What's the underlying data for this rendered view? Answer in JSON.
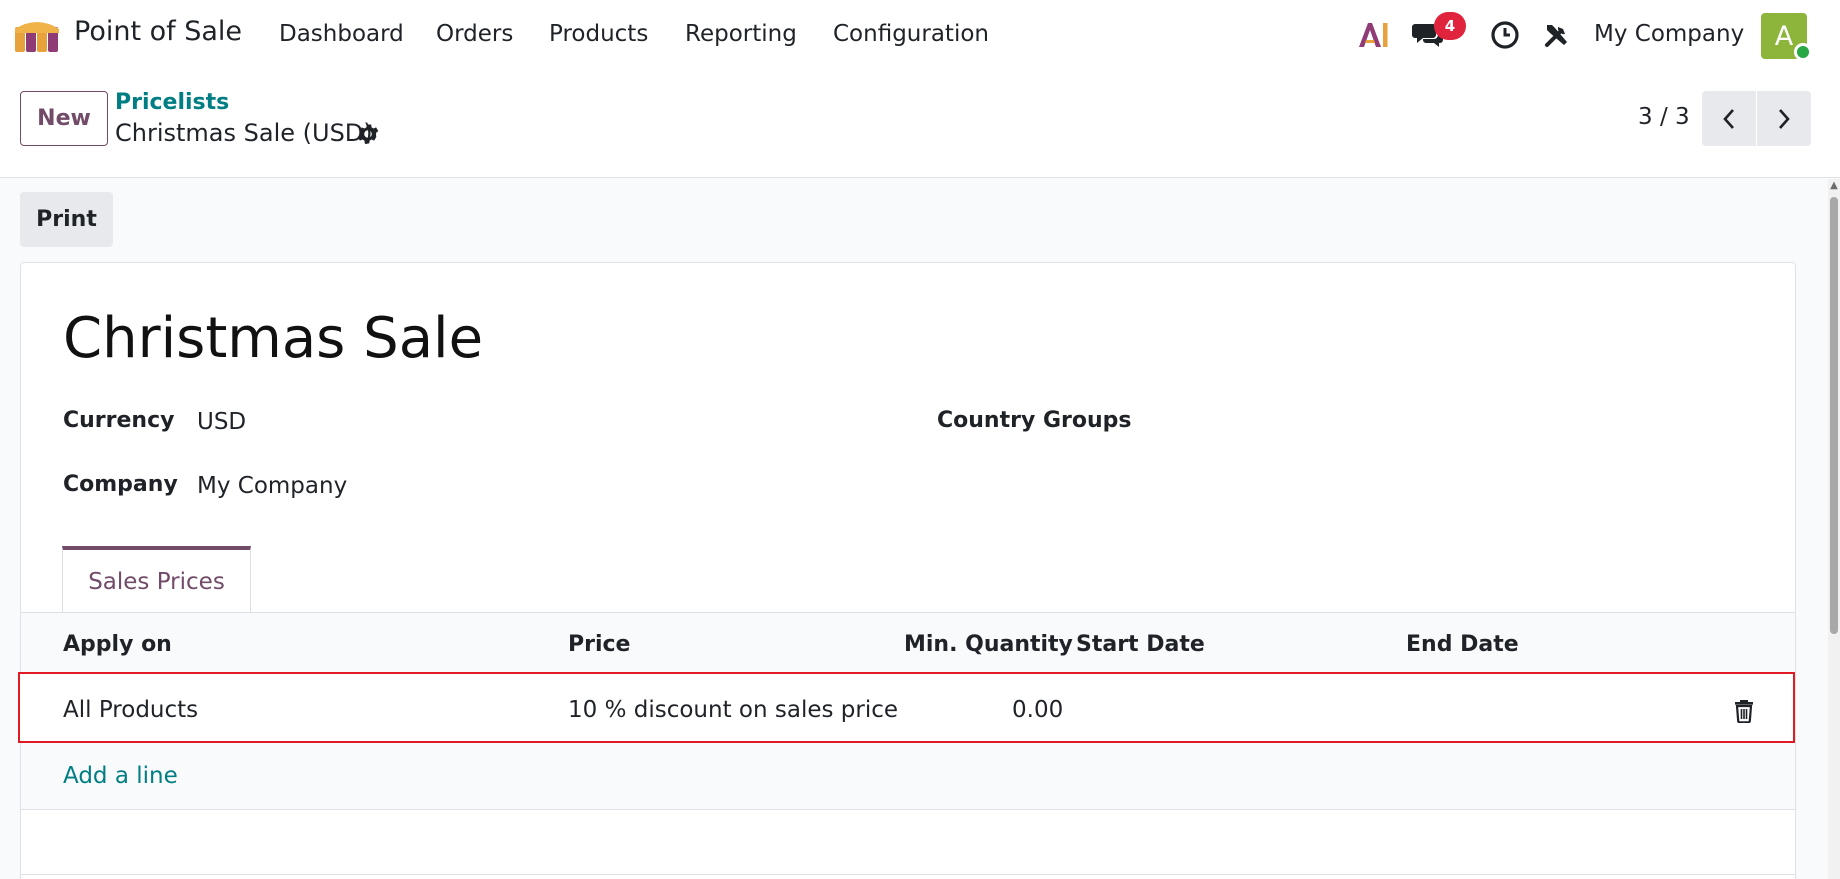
{
  "navbar": {
    "app_name": "Point of Sale",
    "menu": [
      "Dashboard",
      "Orders",
      "Products",
      "Reporting",
      "Configuration"
    ],
    "messages_badge": "4",
    "company": "My Company",
    "avatar_letter": "A",
    "icons": [
      "ai-icon",
      "chat-icon",
      "clock-icon",
      "tools-icon"
    ]
  },
  "control_panel": {
    "new_label": "New",
    "breadcrumb_parent": "Pricelists",
    "breadcrumb_current": "Christmas Sale (USD)",
    "pager": "3 / 3"
  },
  "actions": {
    "print_label": "Print"
  },
  "form": {
    "title": "Christmas Sale",
    "currency_label": "Currency",
    "currency_value": "USD",
    "company_label": "Company",
    "company_value": "My Company",
    "country_groups_label": "Country Groups"
  },
  "tabs": [
    {
      "label": "Sales Prices",
      "active": true
    }
  ],
  "table": {
    "columns": [
      "Apply on",
      "Price",
      "Min. Quantity",
      "Start Date",
      "End Date"
    ],
    "rows": [
      {
        "apply_on": "All Products",
        "price": "10 % discount on sales price",
        "min_quantity": "0.00",
        "start_date": "",
        "end_date": ""
      }
    ],
    "add_line_label": "Add a line"
  },
  "colors": {
    "brand": "#714b67",
    "link": "#017e84",
    "badge": "#e0243e",
    "highlight": "#e01b24",
    "avatar": "#8db53c"
  }
}
